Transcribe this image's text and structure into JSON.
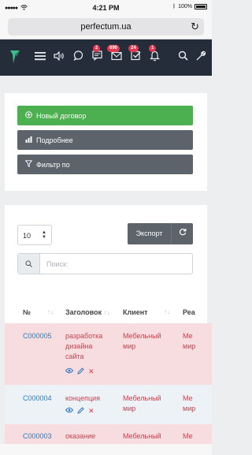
{
  "statusbar": {
    "time": "4:21 PM",
    "battery": "100%"
  },
  "browser": {
    "url": "perfectum.ua",
    "reload_glyph": "↻"
  },
  "header": {
    "badges": {
      "chat": "2",
      "mail": "690",
      "tasks": "24",
      "bell": "1"
    }
  },
  "actions": {
    "new_contract": "Новый договор",
    "details": "Подробнее",
    "filter": "Фильтр по"
  },
  "table_controls": {
    "page_size": "10",
    "export": "Экспорт",
    "search_placeholder": "Поиск:"
  },
  "table": {
    "columns": [
      "№",
      "Заголовок",
      "Клиент",
      "Реа"
    ],
    "rows": [
      {
        "num": "C000005",
        "title_lines": [
          "разработка",
          "дизайна",
          "сайта"
        ],
        "client_lines": [
          "Мебельный",
          "мир"
        ],
        "extra_lines": [
          "Ме",
          "мир"
        ]
      },
      {
        "num": "C000004",
        "title_lines": [
          "концепция"
        ],
        "client_lines": [
          "Мебельный",
          "мир"
        ],
        "extra_lines": [
          "Ме",
          "мир"
        ]
      },
      {
        "num": "C000003",
        "title_lines": [
          "оказание"
        ],
        "client_lines": [
          "Мебельный"
        ],
        "extra_lines": [
          "Ме"
        ]
      }
    ]
  }
}
